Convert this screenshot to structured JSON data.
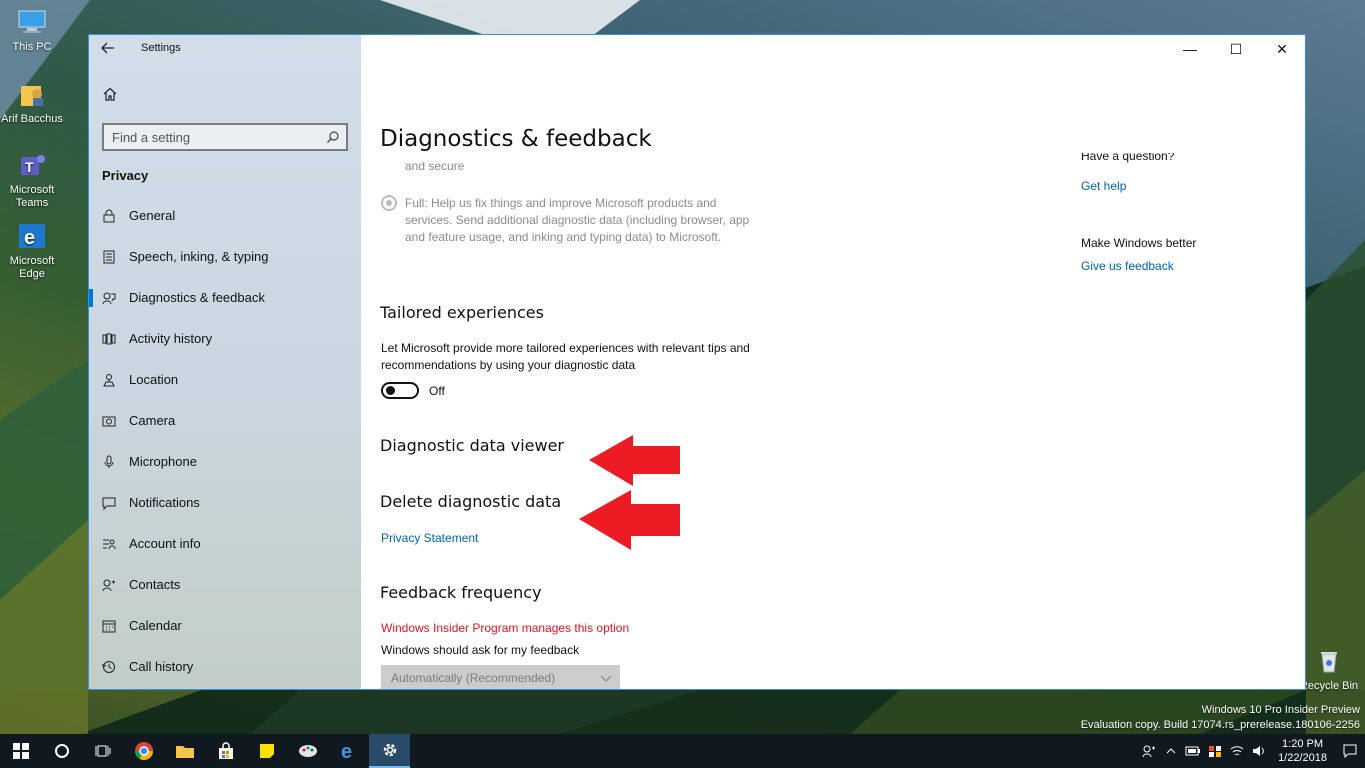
{
  "desktop": {
    "icons": [
      {
        "name": "this-pc",
        "label": "This PC"
      },
      {
        "name": "arif-bacchus",
        "label": "Arif Bacchus"
      },
      {
        "name": "microsoft-teams",
        "label": "Microsoft Teams"
      },
      {
        "name": "microsoft-edge",
        "label": "Microsoft Edge"
      }
    ],
    "recycle_bin": "Recycle Bin",
    "watermark_line1": "Windows 10 Pro Insider Preview",
    "watermark_line2": "Evaluation copy. Build 17074.rs_prerelease.180106-2256"
  },
  "window": {
    "title": "Settings",
    "controls": {
      "minimize": "—",
      "maximize": "☐",
      "close": "✕"
    }
  },
  "nav": {
    "search_placeholder": "Find a setting",
    "section": "Privacy",
    "items": [
      {
        "label": "General",
        "icon": "lock-icon"
      },
      {
        "label": "Speech, inking, & typing",
        "icon": "notebook-icon"
      },
      {
        "label": "Diagnostics & feedback",
        "icon": "feedback-icon",
        "active": true
      },
      {
        "label": "Activity history",
        "icon": "timeline-icon"
      },
      {
        "label": "Location",
        "icon": "location-icon"
      },
      {
        "label": "Camera",
        "icon": "camera-icon"
      },
      {
        "label": "Microphone",
        "icon": "microphone-icon"
      },
      {
        "label": "Notifications",
        "icon": "notifications-icon"
      },
      {
        "label": "Account info",
        "icon": "account-info-icon"
      },
      {
        "label": "Contacts",
        "icon": "contacts-icon"
      },
      {
        "label": "Calendar",
        "icon": "calendar-icon"
      },
      {
        "label": "Call history",
        "icon": "call-history-icon"
      }
    ]
  },
  "content": {
    "title": "Diagnostics & feedback",
    "basic_tail": "and secure",
    "full_option": "Full: Help us fix things and improve Microsoft products and services. Send additional diagnostic data (including browser, app and feature usage, and inking and typing data) to Microsoft.",
    "tailored": {
      "heading": "Tailored experiences",
      "description": "Let Microsoft provide more tailored experiences with relevant tips and recommendations by using your diagnostic data",
      "toggle_state": "Off"
    },
    "viewer_heading": "Diagnostic data viewer",
    "delete_heading": "Delete diagnostic data",
    "privacy_link": "Privacy Statement",
    "feedback": {
      "heading": "Feedback frequency",
      "managed_notice": "Windows Insider Program manages this option",
      "label": "Windows should ask for my feedback",
      "selected": "Automatically (Recommended)"
    },
    "side": {
      "question": "Have a question?",
      "get_help": "Get help",
      "better": "Make Windows better",
      "feedback_link": "Give us feedback"
    }
  },
  "taskbar": {
    "time": "1:20 PM",
    "date": "1/22/2018"
  },
  "colors": {
    "accent": "#0078d7",
    "link": "#0063b1",
    "warning": "#e81123",
    "arrow": "#ed1c24"
  }
}
